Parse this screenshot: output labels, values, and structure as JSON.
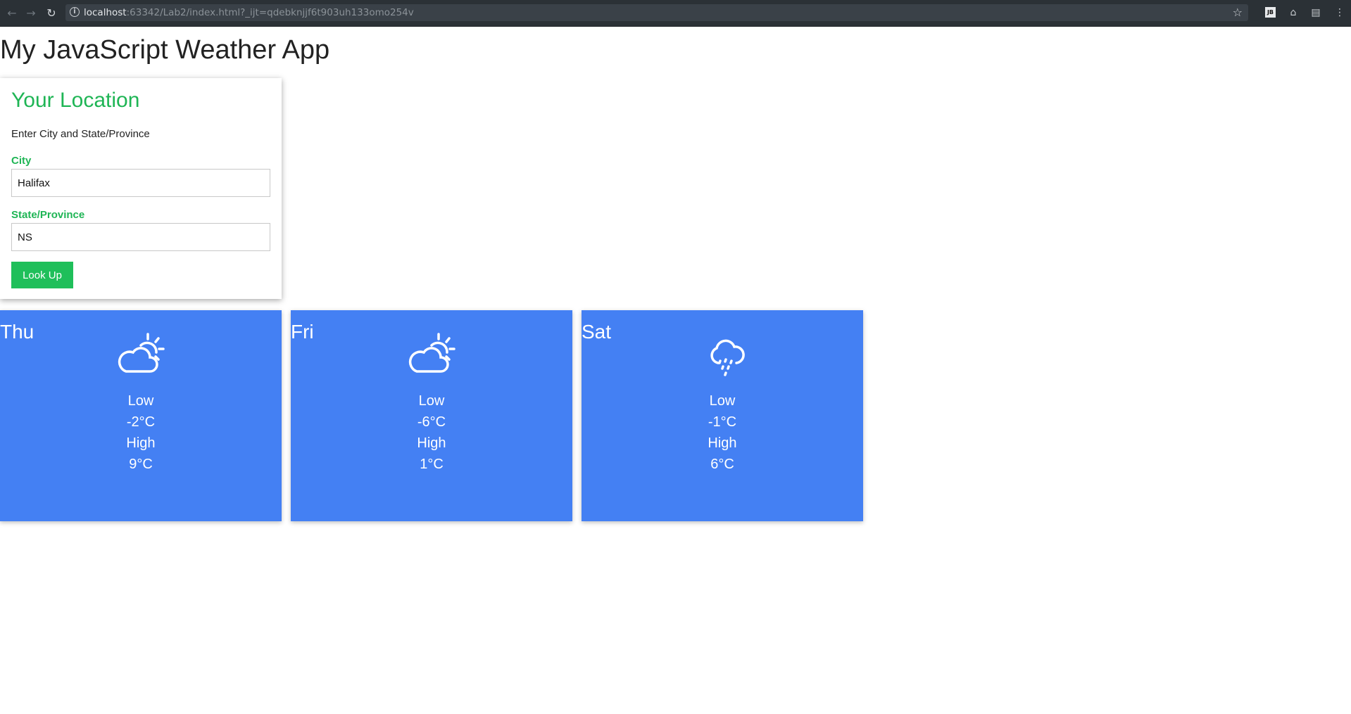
{
  "browser": {
    "url_host": "localhost",
    "url_rest": ":63342/Lab2/index.html?_ijt=qdebknjjf6t903uh133omo254v"
  },
  "page": {
    "title": "My JavaScript Weather App"
  },
  "location": {
    "title": "Your Location",
    "subtitle": "Enter City and State/Province",
    "city_label": "City",
    "city_value": "Halifax",
    "state_label": "State/Province",
    "state_value": "NS",
    "button_label": "Look Up"
  },
  "forecast": [
    {
      "day": "Thu",
      "icon": "partly-cloudy-icon",
      "low_label": "Low",
      "low": "-2°C",
      "high_label": "High",
      "high": "9°C"
    },
    {
      "day": "Fri",
      "icon": "partly-cloudy-icon",
      "low_label": "Low",
      "low": "-6°C",
      "high_label": "High",
      "high": "1°C"
    },
    {
      "day": "Sat",
      "icon": "rain-cloud-icon",
      "low_label": "Low",
      "low": "-1°C",
      "high_label": "High",
      "high": "6°C"
    }
  ],
  "colors": {
    "accent_green": "#1fb555",
    "card_blue": "#4480f3"
  }
}
